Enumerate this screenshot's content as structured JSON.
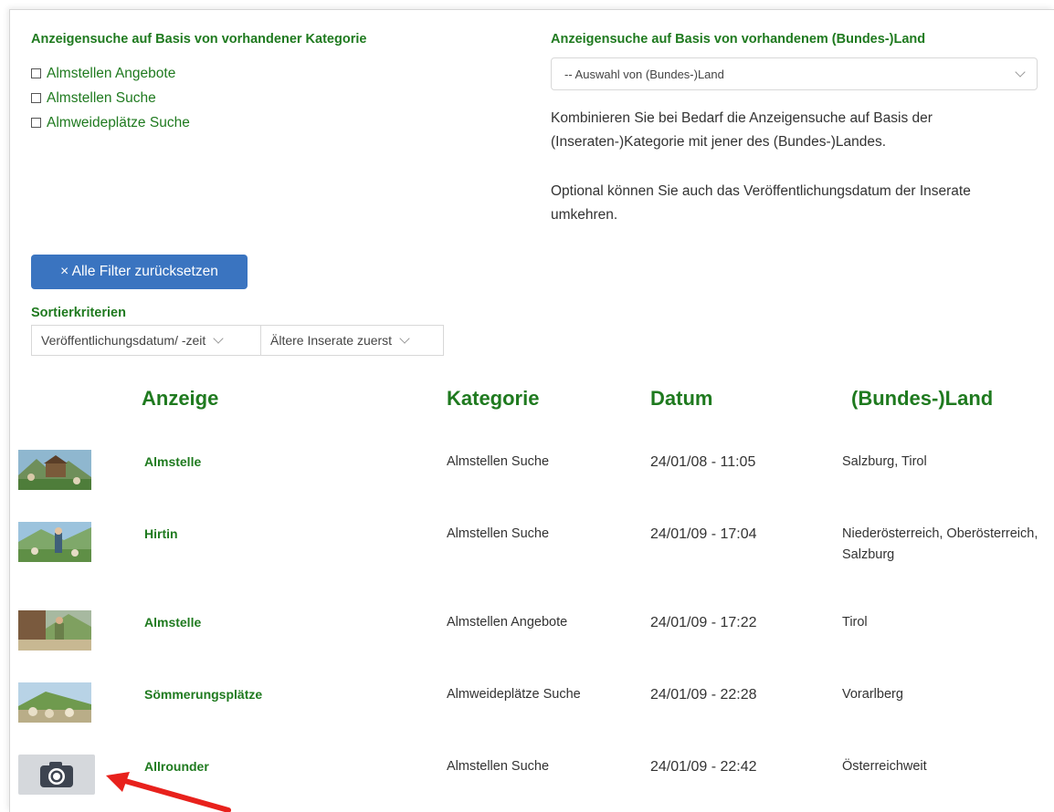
{
  "filters": {
    "category_heading": "Anzeigensuche auf Basis von vorhandener Kategorie",
    "categories": [
      {
        "label": "Almstellen Angebote",
        "checked": false
      },
      {
        "label": "Almstellen Suche",
        "checked": false
      },
      {
        "label": "Almweideplätze Suche",
        "checked": false
      }
    ],
    "land_heading": "Anzeigensuche auf Basis von vorhandenem (Bundes-)Land",
    "land_select": "-- Auswahl von (Bundes-)Land",
    "info_1": "Kombinieren Sie bei Bedarf die Anzeigensuche auf Basis der (Inseraten-)Kategorie mit jener des (Bundes-)Landes.",
    "info_2": "Optional können Sie auch das Veröffentlichungsdatum der Inserate umkehren.",
    "reset_button": "× Alle Filter zurücksetzen"
  },
  "sort": {
    "title": "Sortierkriterien",
    "field": "Veröffentlichungsdatum/ -zeit",
    "order": "Ältere Inserate zuerst"
  },
  "table": {
    "headers": [
      "Anzeige",
      "Kategorie",
      "Datum",
      "(Bundes-)Land"
    ],
    "rows": [
      {
        "title": "Almstelle",
        "category": "Almstellen Suche",
        "date": "24/01/08 - 11:05",
        "land": "Salzburg, Tirol",
        "thumb": "photo"
      },
      {
        "title": "Hirtin",
        "category": "Almstellen Suche",
        "date": "24/01/09 - 17:04",
        "land": "Niederösterreich, Oberösterreich, Salzburg",
        "thumb": "photo"
      },
      {
        "title": "Almstelle",
        "category": "Almstellen Angebote",
        "date": "24/01/09 - 17:22",
        "land": "Tirol",
        "thumb": "photo"
      },
      {
        "title": "Sömmerungsplätze",
        "category": "Almweideplätze Suche",
        "date": "24/01/09 - 22:28",
        "land": "Vorarlberg",
        "thumb": "photo"
      },
      {
        "title": "Allrounder",
        "category": "Almstellen Suche",
        "date": "24/01/09 - 22:42",
        "land": "Österreichweit",
        "thumb": "camera-icon"
      }
    ]
  },
  "colors": {
    "accent_green": "#1f7a1f",
    "button_blue": "#3a74c0",
    "annotation_arrow": "#e8211c"
  }
}
